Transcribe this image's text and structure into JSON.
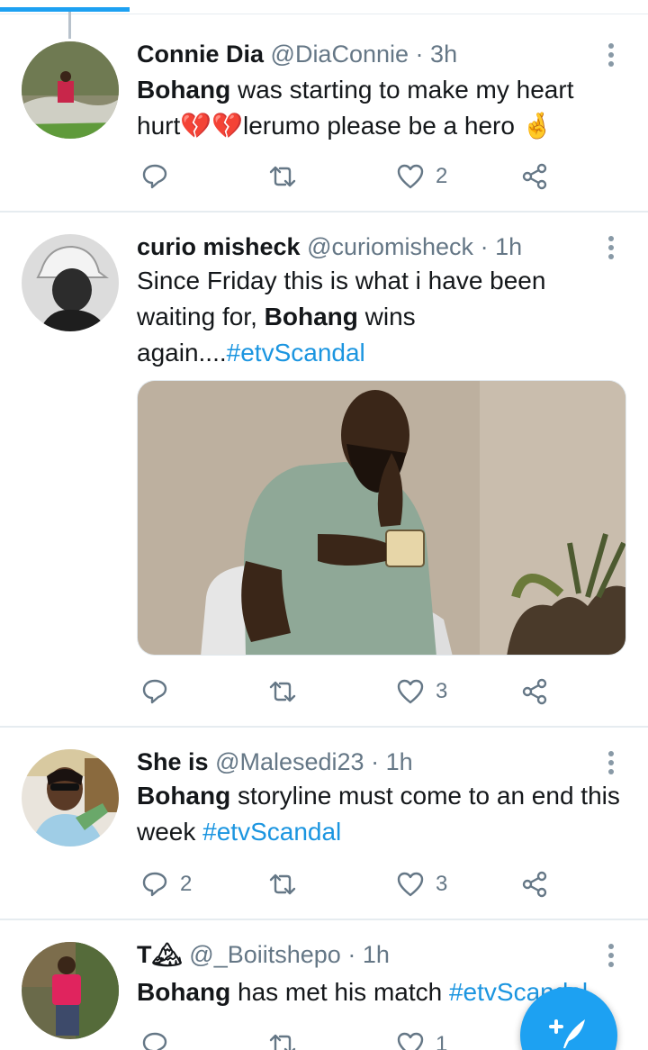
{
  "tweets": [
    {
      "name": "Connie Dia",
      "handle": "@DiaConnie",
      "separator": "·",
      "time": "3h",
      "text_bold": "Bohang",
      "text_rest": " was starting to make my heart hurt💔💔lerumo please be a hero 🤞",
      "reply_count": "",
      "retweet_count": "",
      "like_count": "2"
    },
    {
      "name": "curio misheck",
      "handle": "@curiomisheck",
      "separator": "·",
      "time": "1h",
      "text_pre": "Since Friday this is what i have been waiting for, ",
      "text_bold": "Bohang",
      "text_rest": " wins again....",
      "hashtag": "#etvScandal",
      "reply_count": "",
      "retweet_count": "",
      "like_count": "3"
    },
    {
      "name": "She is",
      "handle": "@Malesedi23",
      "separator": "·",
      "time": "1h",
      "text_bold": "Bohang",
      "text_rest": " storyline must come to an end this week ",
      "hashtag": "#etvScandal",
      "reply_count": "2",
      "retweet_count": "",
      "like_count": "3"
    },
    {
      "name": "T🏔",
      "handle": "@_Boiitshepo",
      "separator": "·",
      "time": "1h",
      "text_bold": "Bohang",
      "text_rest": " has met his match ",
      "hashtag": "#etvScandal",
      "reply_count": "",
      "retweet_count": "",
      "like_count": "1"
    }
  ],
  "colors": {
    "accent": "#1da1f2",
    "hashtag": "#1b95e0",
    "secondary_text": "#657786",
    "divider": "#e6ecf0"
  },
  "icons": [
    "reply-icon",
    "retweet-icon",
    "like-icon",
    "share-icon",
    "more-icon",
    "compose-icon"
  ]
}
